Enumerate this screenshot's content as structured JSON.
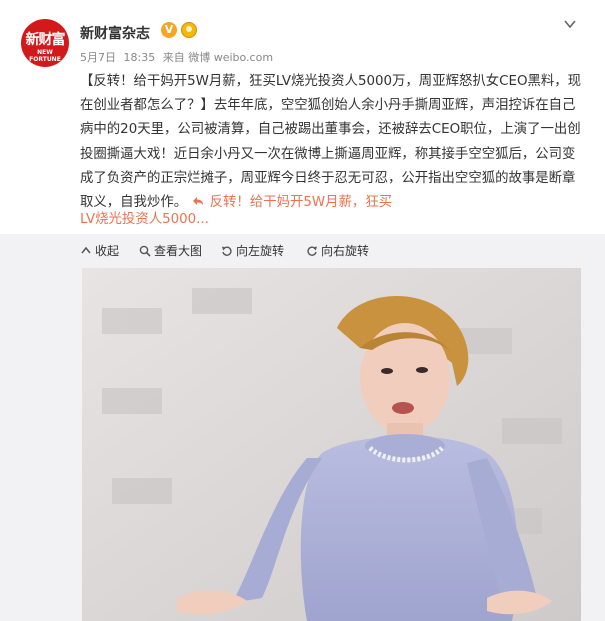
{
  "account": {
    "avatar_line1": "新财富",
    "avatar_line2": "NEW FORTUNE",
    "name": "新财富杂志",
    "verified_icon": "v-verified-icon",
    "date": "5月7日",
    "time": "18:35",
    "source_prefix": "来自",
    "source": "微博 weibo.com"
  },
  "post": {
    "text_main": "【反转！给干妈开5W月薪，狂买LV烧光投资人5000万，周亚辉怒扒女CEO黑料，现在创业者都怎么了？】去年年底，空空狐创始人余小丹手撕周亚辉，声泪控诉在自己病中的20天里，公司被清算，自己被踢出董事会，还被辞去CEO职位，上演了一出创投圈撕逼大戏！近日余小丹又一次在微博上撕逼周亚辉，称其接手空空狐后，公司变成了负资产的正宗烂摊子，周亚辉今日终于忍无可忍，公开指出空空狐的故事是断章取义，自我炒作。",
    "link_icon": "link-icon",
    "link_text_1": "反转！给干妈开5W月薪，狂买",
    "link_text_2": "LV烧光投资人5000..."
  },
  "toolbar": {
    "collapse": "收起",
    "view_large": "查看大图",
    "rotate_left": "向左旋转",
    "rotate_right": "向右旋转"
  },
  "colors": {
    "brand_red": "#d21a1a",
    "link_orange": "#eb7350",
    "toolbar_bg": "#f2f2f5"
  }
}
